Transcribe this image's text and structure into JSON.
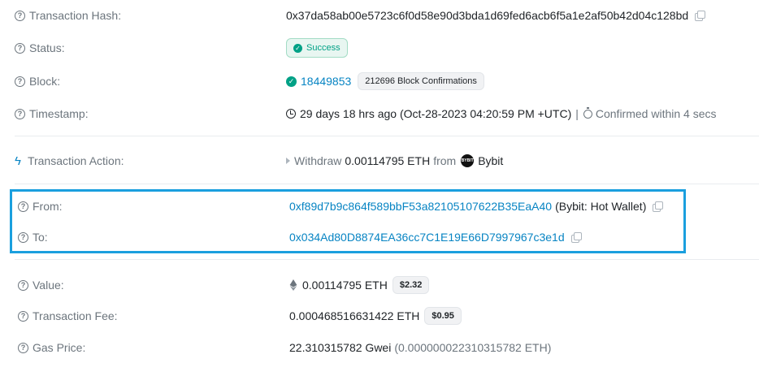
{
  "tx_hash": {
    "label": "Transaction Hash:",
    "value": "0x37da58ab00e5723c6f0d58e90d3bda1d69fed6acb6f5a1e2af50b42d04c128bd"
  },
  "status": {
    "label": "Status:",
    "value": "Success"
  },
  "block": {
    "label": "Block:",
    "number": "18449853",
    "confirmations": "212696 Block Confirmations"
  },
  "timestamp": {
    "label": "Timestamp:",
    "age": "29 days 18 hrs ago (Oct-28-2023 04:20:59 PM +UTC)",
    "separator": "|",
    "confirmed": "Confirmed within 4 secs"
  },
  "action": {
    "label": "Transaction Action:",
    "verb": "Withdraw",
    "amount": "0.00114795 ETH",
    "from_word": "from",
    "exchange": "Bybit",
    "logo_text": "BYBIT"
  },
  "from": {
    "label": "From:",
    "address": "0xf89d7b9c864f589bbF53a82105107622B35EaA40",
    "tag": "(Bybit: Hot Wallet)"
  },
  "to": {
    "label": "To:",
    "address": "0x034Ad80D8874EA36cc7C1E19E66D7997967c3e1d"
  },
  "value": {
    "label": "Value:",
    "amount": "0.00114795 ETH",
    "usd": "$2.32"
  },
  "fee": {
    "label": "Transaction Fee:",
    "amount": "0.000468516631422 ETH",
    "usd": "$0.95"
  },
  "gas": {
    "label": "Gas Price:",
    "gwei": "22.310315782 Gwei",
    "eth": "(0.000000022310315782 ETH)"
  },
  "colors": {
    "link": "#0784c3",
    "success": "#00a186",
    "highlight": "#1a9fde"
  }
}
